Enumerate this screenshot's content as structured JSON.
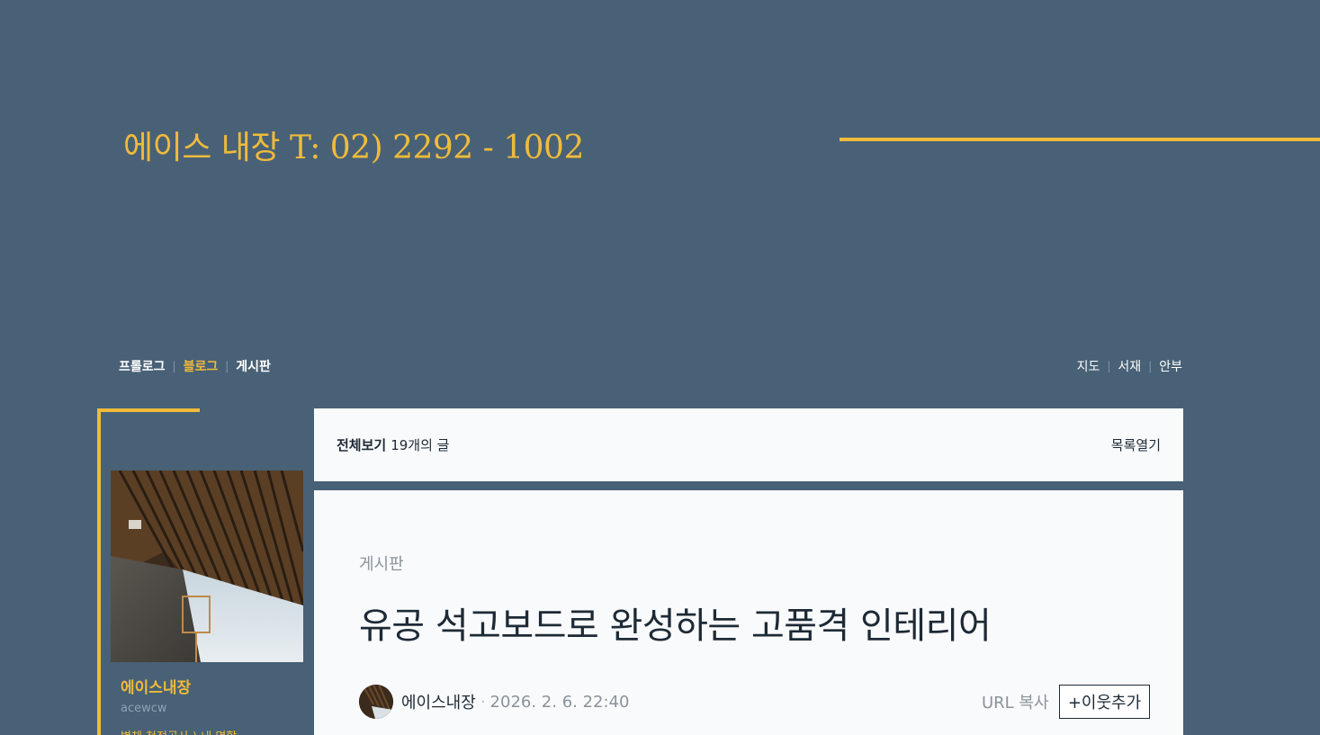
{
  "header": {
    "blog_title": "에이스 내장 T: 02) 2292 - 1002",
    "accent_color": "#f0bb3a",
    "background_color": "#486176"
  },
  "menu": {
    "left": [
      {
        "label": "프롤로그",
        "active": false
      },
      {
        "label": "블로그",
        "active": true
      },
      {
        "label": "게시판",
        "active": false
      }
    ],
    "right": [
      {
        "label": "지도"
      },
      {
        "label": "서재"
      },
      {
        "label": "안부"
      }
    ]
  },
  "profile": {
    "name": "에이스내장",
    "id": "acewcw",
    "desc": "벽체 천정공사 ) 내 명함"
  },
  "list_bar": {
    "all_label": "전체보기",
    "count": "19개의 글",
    "open_list": "목록열기"
  },
  "post": {
    "category": "게시판",
    "title": "유공 석고보드로 완성하는 고품격 인테리어",
    "author": "에이스내장",
    "separator": "·",
    "date": "2026. 2. 6. 22:40",
    "url_copy": "URL 복사",
    "add_neighbor": "+이웃추가"
  }
}
